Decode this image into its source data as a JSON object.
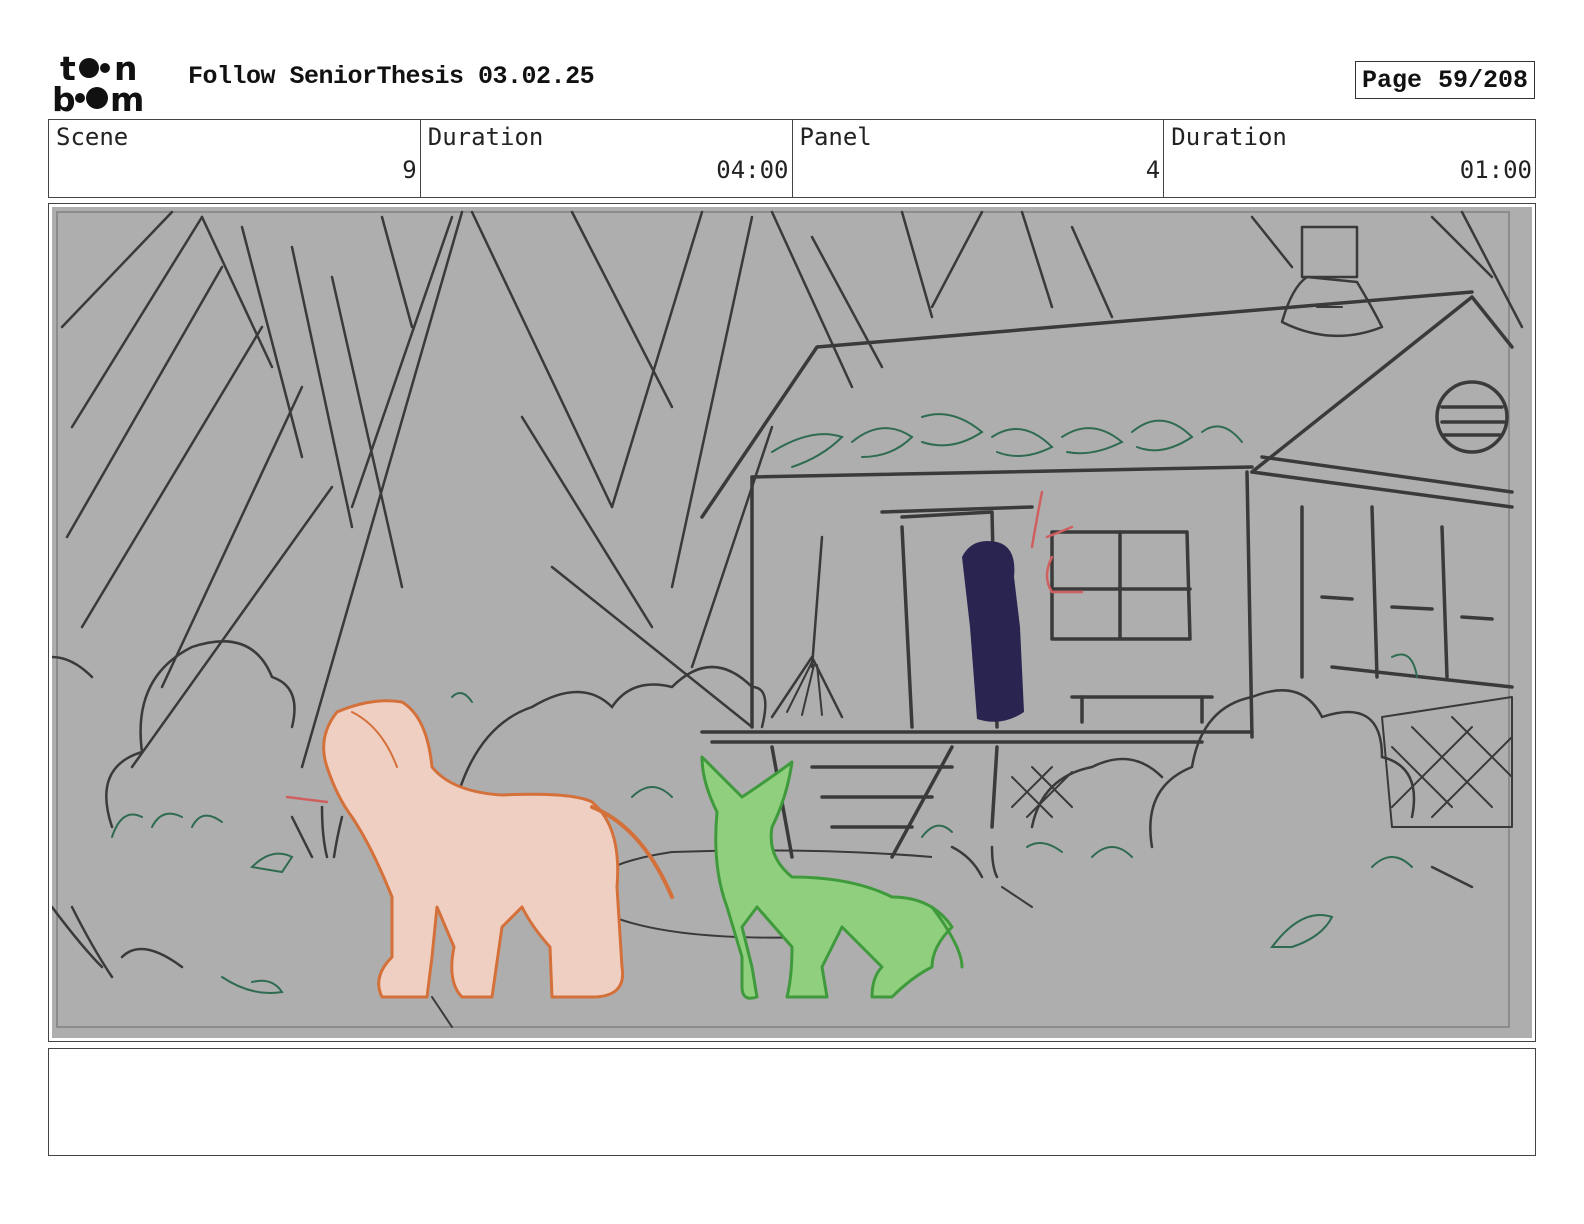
{
  "header": {
    "logo_name": "toon boom",
    "project_title": "Follow SeniorThesis 03.02.25",
    "page_label": "Page",
    "page_value": "59/208"
  },
  "info": {
    "scene_label": "Scene",
    "scene_value": "9",
    "scene_duration_label": "Duration",
    "scene_duration_value": "04:00",
    "panel_label": "Panel",
    "panel_value": "4",
    "panel_duration_label": "Duration",
    "panel_duration_value": "01:00"
  },
  "colors": {
    "panel_bg": "#aeaeae",
    "sketch_line": "#3a3a3a",
    "dog_fill": "#f0cfc3",
    "dog_line": "#d4703a",
    "fox_fill": "#8fcf7d",
    "fox_line": "#3f9a3c",
    "figure_fill": "#2a2550",
    "foliage_line": "#2f6b50",
    "red_mark": "#d06060"
  },
  "notes": {
    "text": ""
  }
}
